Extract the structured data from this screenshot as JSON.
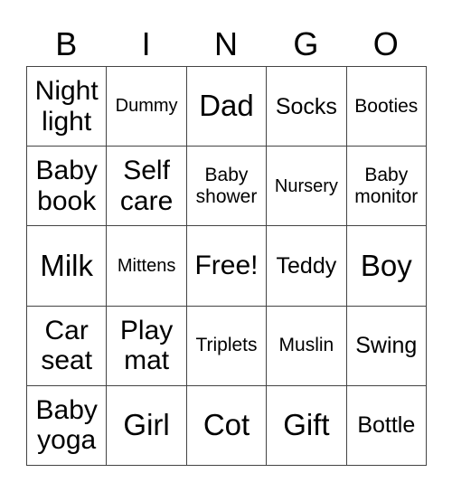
{
  "header": [
    "B",
    "I",
    "N",
    "G",
    "O"
  ],
  "cells": [
    [
      "Night light",
      "Dummy",
      "Dad",
      "Socks",
      "Booties"
    ],
    [
      "Baby book",
      "Self care",
      "Baby shower",
      "Nursery",
      "Baby monitor"
    ],
    [
      "Milk",
      "Mittens",
      "Free!",
      "Teddy",
      "Boy"
    ],
    [
      "Car seat",
      "Play mat",
      "Triplets",
      "Muslin",
      "Swing"
    ],
    [
      "Baby yoga",
      "Girl",
      "Cot",
      "Gift",
      "Bottle"
    ]
  ]
}
